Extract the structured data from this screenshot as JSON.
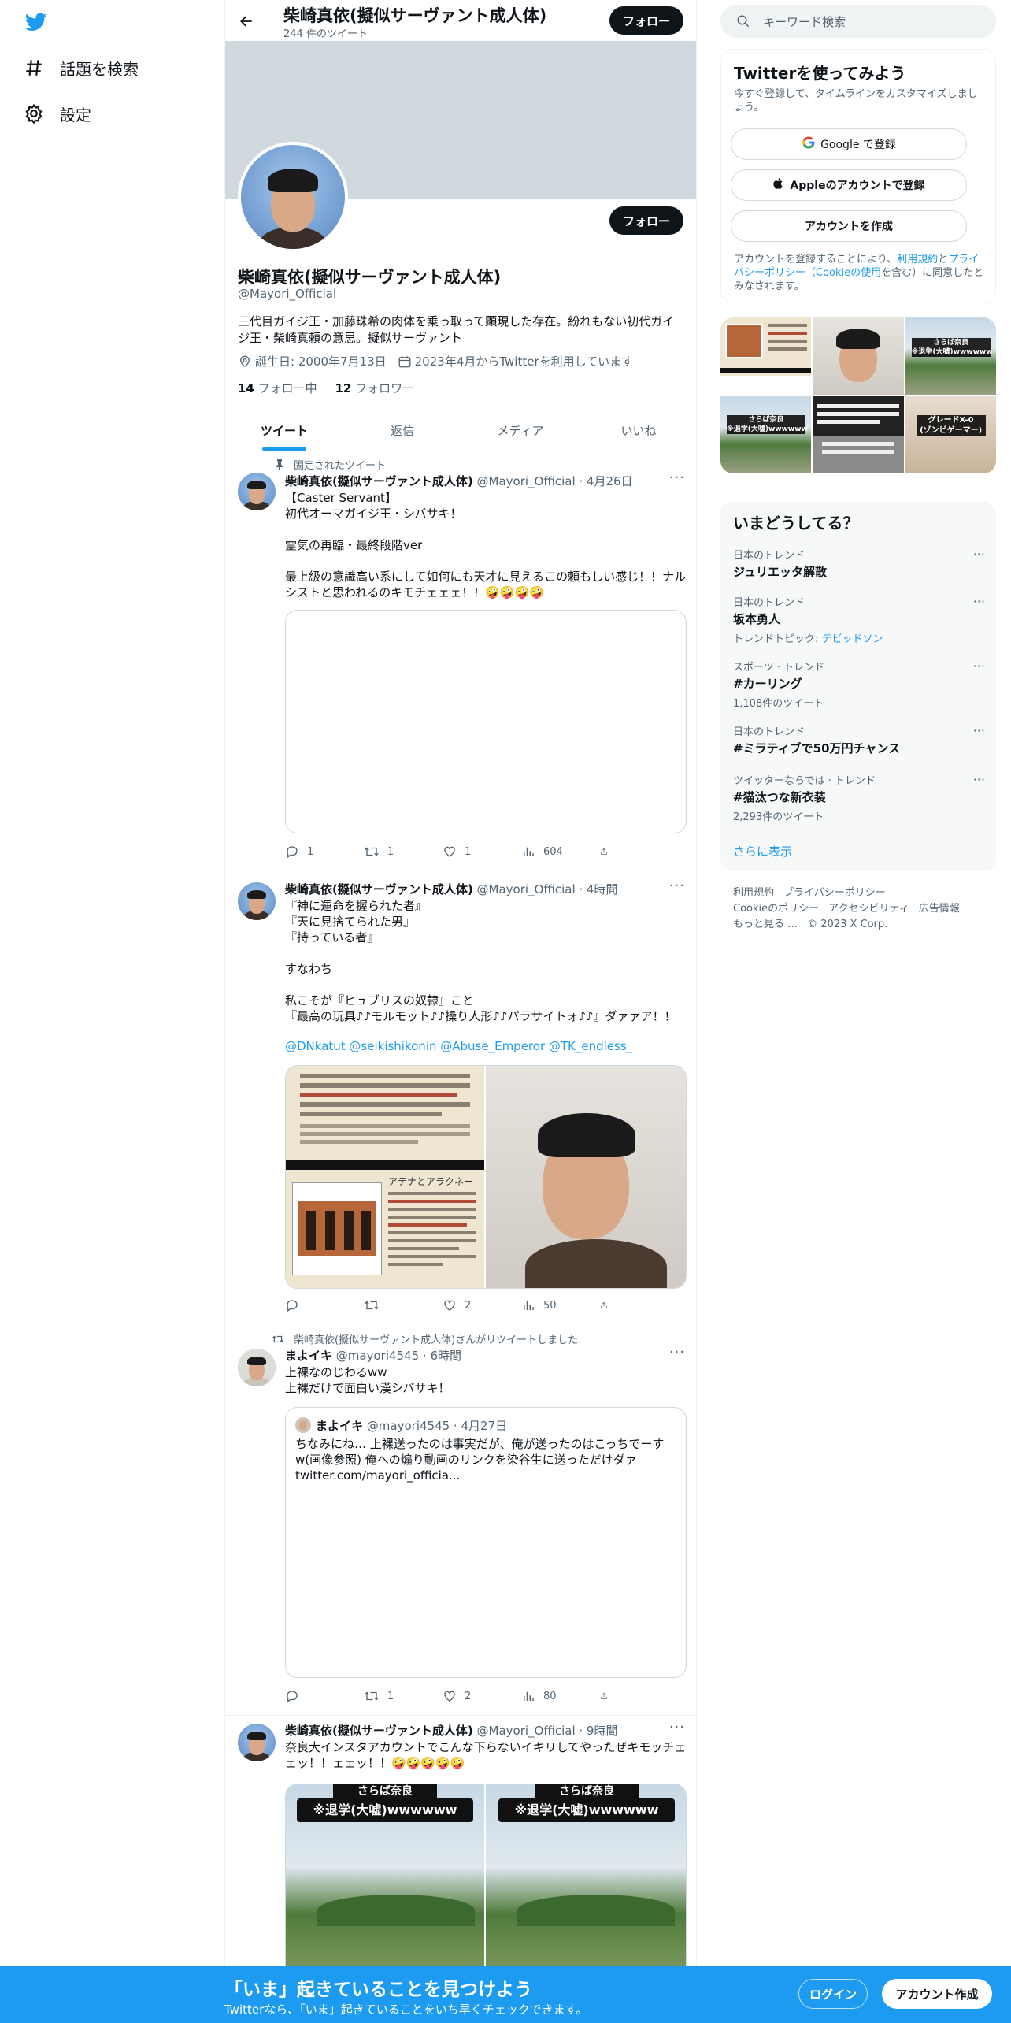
{
  "nav": {
    "explore_label": "話題を検索",
    "settings_label": "設定"
  },
  "header": {
    "name": "柴崎真依(擬似サーヴァント成人体)",
    "tweet_count": "244 件のツイート",
    "follow_label": "フォロー"
  },
  "profile": {
    "name": "柴崎真依(擬似サーヴァント成人体)",
    "handle": "@Mayori_Official",
    "bio": "三代目ガイジ王・加藤珠希の肉体を乗っ取って顕現した存在。紛れもない初代ガイジ王・柴崎真頼の意思。擬似サーヴァント",
    "birthday": "誕生日: 2000年7月13日",
    "joined": "2023年4月からTwitterを利用しています",
    "following_count": "14",
    "following_label": "フォロー中",
    "followers_count": "12",
    "followers_label": "フォロワー",
    "follow_label": "フォロー"
  },
  "tabs": [
    {
      "label": "ツイート"
    },
    {
      "label": "返信"
    },
    {
      "label": "メディア"
    },
    {
      "label": "いいね"
    }
  ],
  "tweets": [
    {
      "context": "固定されたツイート",
      "name": "柴崎真依(擬似サーヴァント成人体)",
      "meta": "@Mayori_Official · 4月26日",
      "body": "【Caster Servant】\n初代オーマガイジ王・シバサキ！\n\n霊気の再臨・最終段階ver\n\n最上級の意識高い系にして如何にも天才に見えるこの頼もしい感じ！！ナルシストと思われるのキモチェェェ！！🤪🤪🤪🤪",
      "replies": "1",
      "retweets": "1",
      "likes": "1",
      "views": "604"
    },
    {
      "name": "柴崎真依(擬似サーヴァント成人体)",
      "meta": "@Mayori_Official · 4時間",
      "body": "『神に運命を握られた者』\n『天に見捨てられた男』\n『持っている者』\n\nすなわち\n\n私こそが『ヒュブリスの奴隷』こと\n『最高の玩具♪♪モルモット♪♪操り人形♪♪パラサイトォ♪♪』ダァァア！！",
      "mentions": "@DNkatut @seikishikonin @Abuse_Emperor @TK_endless_",
      "doc_title": "アテナとアラクネー",
      "replies": "",
      "retweets": "",
      "likes": "2",
      "views": "50"
    },
    {
      "context": "柴崎真依(擬似サーヴァント成人体)さんがリツイートしました",
      "name": "まよイキ",
      "meta": "@mayori4545 · 6時間",
      "body": "上裸なのじわるww\n上裸だけで面白い漢シバサキ！",
      "quote_name": "まよイキ",
      "quote_meta": "@mayori4545 · 4月27日",
      "quote_body": "ちなみにね… 上裸送ったのは事実だが、俺が送ったのはこっちでーすw(画像参照) 俺への煽り動画のリンクを染谷生に送っただけダァ\ntwitter.com/mayori_officia...",
      "replies": "",
      "retweets": "1",
      "likes": "2",
      "views": "80"
    },
    {
      "name": "柴崎真依(擬似サーヴァント成人体)",
      "meta": "@Mayori_Official · 9時間",
      "body": "奈良大インスタアカウントでこんな下らないイキリしてやったぜキモッチェェッ！！ェェッ！！🤪🤪🤪🤪🤪",
      "img_caption_top": "さらば奈良",
      "img_caption_main": "※退学(大嘘)wwwwww"
    }
  ],
  "right": {
    "search_placeholder": "キーワード検索",
    "signup_title": "Twitterを使ってみよう",
    "signup_sub": "今すぐ登録して、タイムラインをカスタマイズしましょう。",
    "google_label": "Google で登録",
    "apple_label": "Appleのアカウントで登録",
    "create_label": "アカウントを作成",
    "legal_pre": "アカウントを登録することにより、",
    "legal_terms": "利用規約",
    "legal_and": "と",
    "legal_privacy": "プライバシーポリシー（Cookieの使用",
    "legal_post": "を含む）に同意したとみなされます。",
    "photo_captions": [
      "さらば奈良\n※退学(大嘘)wwwwww",
      "さらば奈良\n※退学(大嘘)wwwwww",
      "グレードX-0\n(ゾンビゲーマー)"
    ],
    "trends_title": "いまどうしてる？",
    "trends": [
      {
        "context": "日本のトレンド",
        "title": "ジュリエッタ解散",
        "sub": ""
      },
      {
        "context": "日本のトレンド",
        "title": "坂本勇人",
        "sub_pre": "トレンドトピック: ",
        "sub_link": "デビッドソン"
      },
      {
        "context": "スポーツ · トレンド",
        "title": "#カーリング",
        "sub": "1,108件のツイート"
      },
      {
        "context": "日本のトレンド",
        "title": "#ミラティブで50万円チャンス",
        "sub": ""
      },
      {
        "context": "ツイッターならでは · トレンド",
        "title": "#猫汰つな新衣装",
        "sub": "2,293件のツイート"
      }
    ],
    "show_more": "さらに表示",
    "footer": [
      "利用規約",
      "プライバシーポリシー",
      "Cookieのポリシー",
      "アクセシビリティ",
      "広告情報",
      "もっと見る …",
      "© 2023 X Corp."
    ]
  },
  "bottom": {
    "title": "「いま」起きていることを見つけよう",
    "sub": "Twitterなら、「いま」起きていることをいち早くチェックできます。",
    "login": "ログイン",
    "signup": "アカウント作成"
  },
  "colors": {
    "accent": "#1d9bf0",
    "text": "#0f1419",
    "muted": "#536471"
  }
}
